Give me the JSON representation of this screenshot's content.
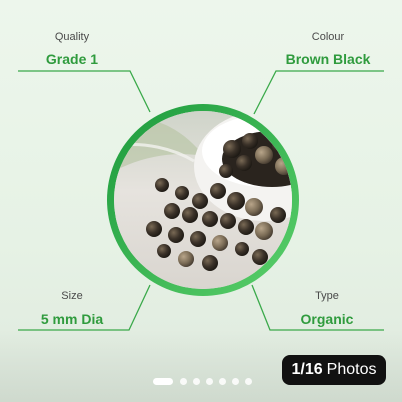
{
  "specs": {
    "quality": {
      "label": "Quality",
      "value": "Grade 1"
    },
    "colour": {
      "label": "Colour",
      "value": "Brown Black"
    },
    "size": {
      "label": "Size",
      "value": "5 mm Dia"
    },
    "type": {
      "label": "Type",
      "value": "Organic"
    }
  },
  "photo": {
    "subject": "black peppercorns spilling from white bowl"
  },
  "gallery": {
    "current": "1/16",
    "suffix": "Photos",
    "dot_count": 7,
    "active_dot": 0
  },
  "colors": {
    "accent": "#2f9b3d",
    "ring": "#1c9a3c",
    "background": "#e8f3e7",
    "badge": "#111111"
  }
}
